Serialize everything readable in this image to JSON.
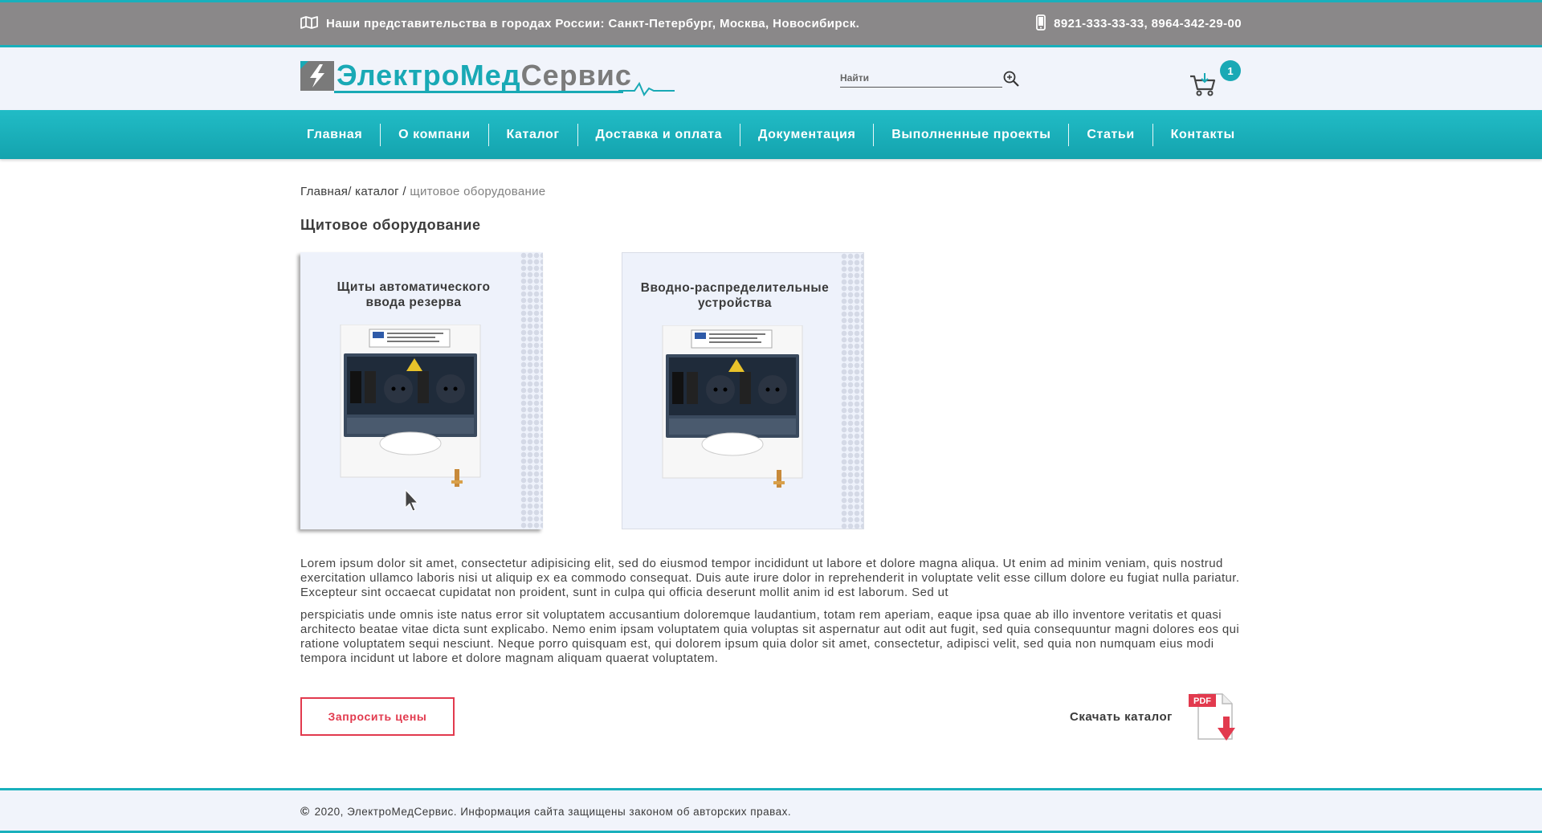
{
  "topbar": {
    "offices_text": "Наши представительства в городах России: Санкт-Петербург, Москва, Новосибирск.",
    "phones_text": "8921-333-33-33, 8964-342-29-00",
    "map_icon": "map-icon",
    "phone_icon": "phone-icon"
  },
  "header": {
    "logo_part1": "Электро",
    "logo_part2": "Мед",
    "logo_part3": "Сервис",
    "search_placeholder": "Найти",
    "cart_count": "1"
  },
  "nav": {
    "items": [
      "Главная",
      "О компани",
      "Каталог",
      "Доставка и оплата",
      "Документация",
      "Выполненные проекты",
      "Статьи",
      "Контакты"
    ]
  },
  "breadcrumb": {
    "home": "Главная",
    "sep1": "/ ",
    "catalog": "каталог",
    "sep2": " / ",
    "current": "щитовое оборудование"
  },
  "page": {
    "title": "Щитовое оборудование",
    "cards": [
      {
        "title": "Щиты автоматического ввода резерва"
      },
      {
        "title": "Вводно-распределительные устройства"
      }
    ],
    "paragraph1": "Lorem ipsum dolor sit amet, consectetur adipisicing elit, sed do eiusmod tempor incididunt ut labore et dolore magna aliqua. Ut enim ad minim veniam, quis nostrud exercitation ullamco laboris nisi ut aliquip ex ea commodo consequat. Duis aute irure dolor in reprehenderit in voluptate velit esse cillum dolore eu fugiat nulla pariatur. Excepteur sint occaecat cupidatat non proident, sunt in culpa qui officia deserunt mollit anim id est laborum. Sed ut",
    "paragraph2": "perspiciatis unde omnis iste natus error sit voluptatem accusantium doloremque laudantium, totam rem aperiam, eaque ipsa quae ab illo inventore veritatis et quasi architecto beatae vitae dicta sunt explicabo. Nemo enim ipsam voluptatem quia voluptas sit aspernatur aut odit aut fugit, sed quia consequuntur magni dolores eos qui ratione voluptatem sequi nesciunt. Neque porro quisquam est, qui dolorem ipsum quia dolor sit amet, consectetur, adipisci velit, sed quia non numquam eius modi tempora incidunt ut labore et dolore magnam aliquam quaerat voluptatem.",
    "request_price_label": "Запросить цены",
    "download_label": "Скачать каталог",
    "pdf_badge": "PDF"
  },
  "footer": {
    "copyright_symbol": "©",
    "text": "2020, ЭлектроМедСервис. Информация сайта защищены законом об авторских правах."
  },
  "colors": {
    "accent": "#19b0bc",
    "topbar_bg": "#8a8889",
    "header_bg": "#f1f4fb",
    "button_red": "#e23a4e"
  }
}
